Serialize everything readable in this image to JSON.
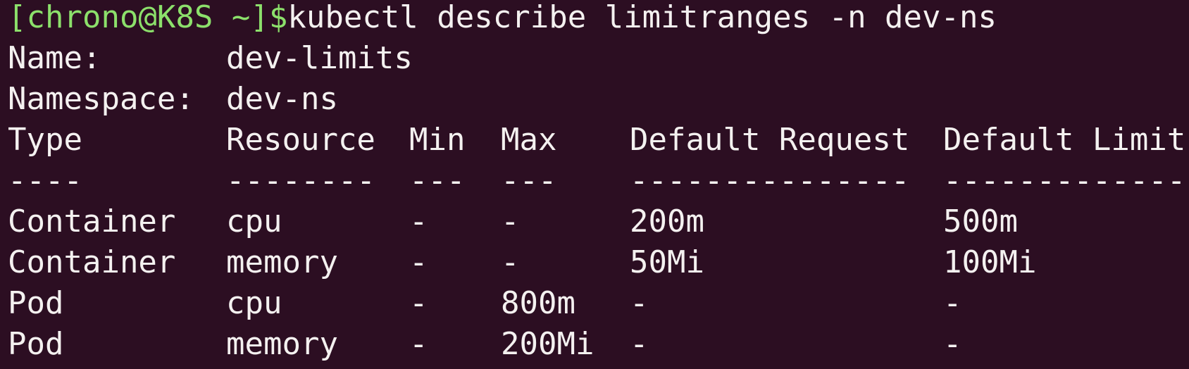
{
  "prompt": {
    "text": "[chrono@K8S ~]$",
    "command": "kubectl describe limitranges -n dev-ns"
  },
  "meta": {
    "name_label": "Name:",
    "name_value": "dev-limits",
    "namespace_label": "Namespace:",
    "namespace_value": "dev-ns"
  },
  "table": {
    "headers": [
      "Type",
      "Resource",
      "Min",
      "Max",
      "Default Request",
      "Default Limit"
    ],
    "separators": [
      "----",
      "--------",
      "---",
      "---",
      "---------------",
      "-------------"
    ],
    "rows": [
      [
        "Container",
        "cpu",
        "-",
        "-",
        "200m",
        "500m"
      ],
      [
        "Container",
        "memory",
        "-",
        "-",
        "50Mi",
        "100Mi"
      ],
      [
        "Pod",
        "cpu",
        "-",
        "800m",
        "-",
        "-"
      ],
      [
        "Pod",
        "memory",
        "-",
        "200Mi",
        "-",
        "-"
      ]
    ]
  },
  "colors": {
    "background": "#2c0e22",
    "text": "#f4f1f0",
    "prompt": "#8ce06b"
  }
}
